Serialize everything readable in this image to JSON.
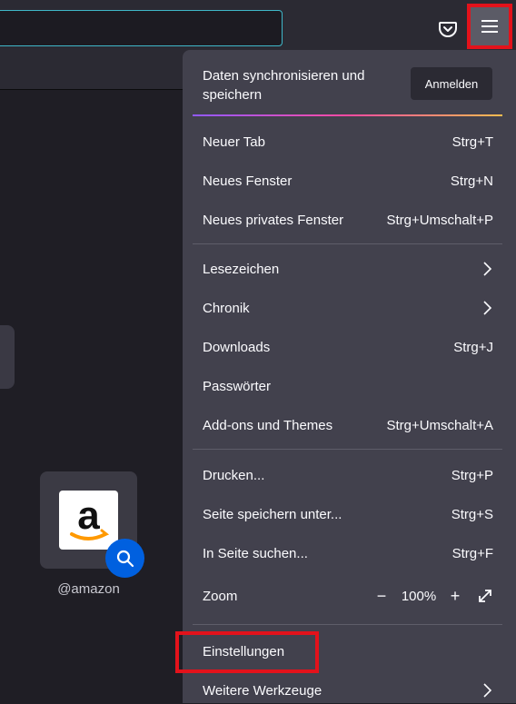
{
  "colors": {
    "accent_highlight": "#e3121b",
    "panel_bg": "#42414d",
    "page_bg": "#1f1e25"
  },
  "toolbar": {
    "pocket_icon": "pocket-icon",
    "menu_icon": "hamburger-menu-icon"
  },
  "shortcut_tile": {
    "label": "@amazon",
    "logo_text": "a"
  },
  "panel": {
    "sync_title": "Daten synchronisieren und speichern",
    "sync_button": "Anmelden",
    "items": [
      {
        "label": "Neuer Tab",
        "shortcut": "Strg+T"
      },
      {
        "label": "Neues Fenster",
        "shortcut": "Strg+N"
      },
      {
        "label": "Neues privates Fenster",
        "shortcut": "Strg+Umschalt+P"
      },
      {
        "label": "Lesezeichen",
        "shortcut": ""
      },
      {
        "label": "Chronik",
        "shortcut": ""
      },
      {
        "label": "Downloads",
        "shortcut": "Strg+J"
      },
      {
        "label": "Passwörter",
        "shortcut": ""
      },
      {
        "label": "Add-ons und Themes",
        "shortcut": "Strg+Umschalt+A"
      },
      {
        "label": "Drucken...",
        "shortcut": "Strg+P"
      },
      {
        "label": "Seite speichern unter...",
        "shortcut": "Strg+S"
      },
      {
        "label": "In Seite suchen...",
        "shortcut": "Strg+F"
      },
      {
        "label": "Einstellungen",
        "shortcut": ""
      },
      {
        "label": "Weitere Werkzeuge",
        "shortcut": ""
      }
    ],
    "zoom": {
      "label": "Zoom",
      "minus": "−",
      "value": "100%",
      "plus": "+"
    }
  }
}
